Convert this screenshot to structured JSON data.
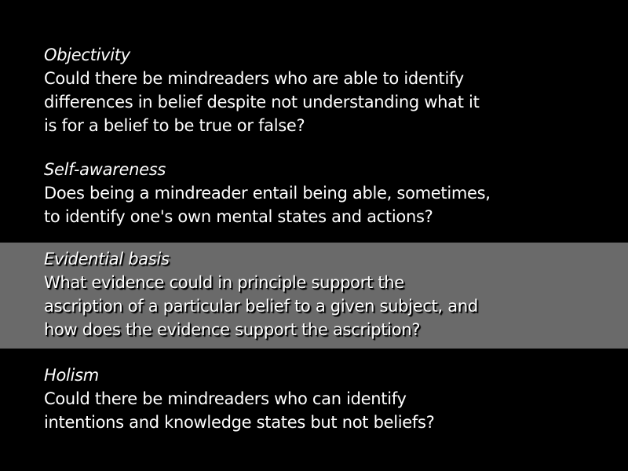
{
  "sections": [
    {
      "title": "Objectivity",
      "lines": [
        "Could there be mindreaders who are able to identify",
        "differences in belief despite not understanding what it",
        "is for a belief to be true or false?"
      ]
    },
    {
      "title": "Self-awareness",
      "lines": [
        "Does being a mindreader entail being able, sometimes,",
        "to identify one's own mental states and actions?"
      ]
    },
    {
      "title": "Evidential basis",
      "highlighted": true,
      "lines": [
        "What evidence could in principle support the",
        "ascription of a particular belief to a given subject, and",
        "how does the evidence support the ascription?"
      ]
    },
    {
      "title": "Holism",
      "lines": [
        "Could there be mindreaders who can identify",
        "intentions and knowledge states but not beliefs?"
      ]
    }
  ],
  "colors": {
    "background": "#000000",
    "text": "#ffffff",
    "highlight": "#6a6a6a"
  }
}
